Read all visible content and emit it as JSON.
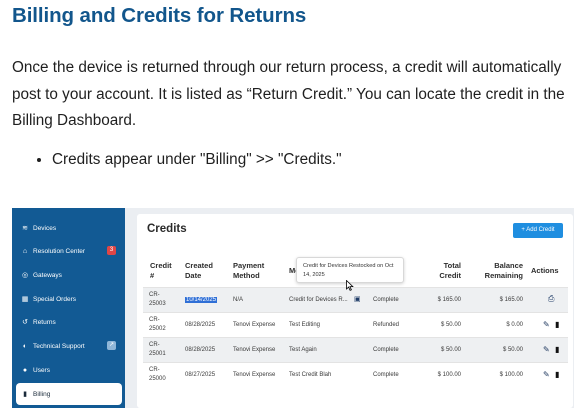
{
  "heading": "Billing and Credits for Returns",
  "paragraph": "Once the device is returned through our return process, a credit will automatically post to your account. It is listed as “Return Credit.” You can locate the credit in the Billing Dashboard.",
  "bullets": [
    "Credits appear under \"Billing\" >> \"Credits.\""
  ],
  "sidebar": {
    "items": [
      {
        "label": "Devices",
        "icon": "wifi-icon",
        "glyph": "≋"
      },
      {
        "label": "Resolution Center",
        "icon": "home-icon",
        "glyph": "⌂",
        "badge": "3",
        "badge_color": "#e04646"
      },
      {
        "label": "Gateways",
        "icon": "target-icon",
        "glyph": "◎"
      },
      {
        "label": "Special Orders",
        "icon": "gift-icon",
        "glyph": "▦"
      },
      {
        "label": "Returns",
        "icon": "return-icon",
        "glyph": "↺"
      },
      {
        "label": "Technical Support",
        "icon": "support-icon",
        "glyph": "◐",
        "badge": "↗",
        "badge_color": "#8fb6d8"
      },
      {
        "label": "Users",
        "icon": "user-icon",
        "glyph": "●"
      },
      {
        "label": "Billing",
        "icon": "document-icon",
        "glyph": "▮"
      }
    ]
  },
  "credits": {
    "title": "Credits",
    "add_button": "+ Add Credit",
    "columns": {
      "credit_no": [
        "Credit",
        "#"
      ],
      "created": [
        "Created",
        "Date"
      ],
      "payment": [
        "Payment",
        "Method"
      ],
      "memo": "Me",
      "total": [
        "Total",
        "Credit"
      ],
      "balance": [
        "Balance",
        "Remaining"
      ],
      "actions": "Actions"
    },
    "tooltip": "Credit for Devices Restocked on Oct 14, 2025",
    "rows": [
      {
        "credit_no": [
          "CR-",
          "25003"
        ],
        "date": "10/14/2025",
        "method": "N/A",
        "memo": "Credit for Devices R...",
        "status": "Complete",
        "total": "$ 165.00",
        "balance": "$ 165.00"
      },
      {
        "credit_no": [
          "CR-",
          "25002"
        ],
        "date": "08/28/2025",
        "method": "Tenovi Expense",
        "memo": "Test Editing",
        "status": "Refunded",
        "total": "$ 50.00",
        "balance": "$ 0.00"
      },
      {
        "credit_no": [
          "CR-",
          "25001"
        ],
        "date": "08/28/2025",
        "method": "Tenovi Expense",
        "memo": "Test Again",
        "status": "Complete",
        "total": "$ 50.00",
        "balance": "$ 50.00"
      },
      {
        "credit_no": [
          "CR-",
          "25000"
        ],
        "date": "08/27/2025",
        "method": "Tenovi Expense",
        "memo": "Test Credit Blah",
        "status": "Complete",
        "total": "$ 100.00",
        "balance": "$ 100.00"
      }
    ]
  },
  "colors": {
    "heading": "#12568c",
    "sidebar": "#125a94",
    "button": "#1f8ee0"
  }
}
